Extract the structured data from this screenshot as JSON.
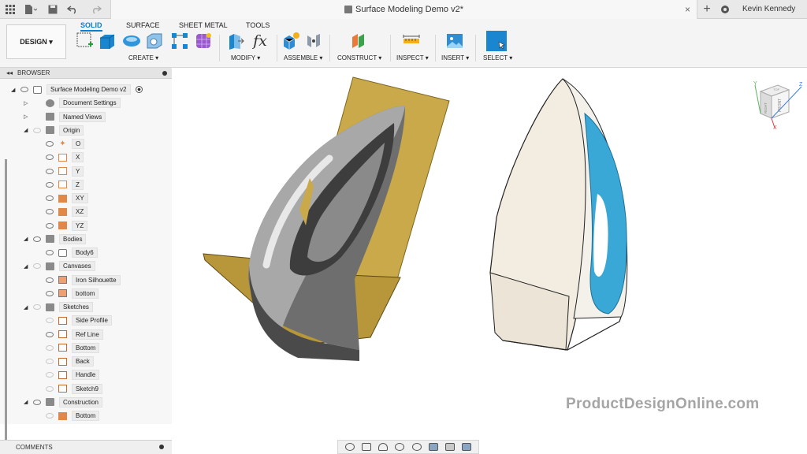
{
  "titlebar": {
    "document_title": "Surface Modeling Demo v2*",
    "user_name": "Kevin Kennedy",
    "close_glyph": "×",
    "add_glyph": "+"
  },
  "ribbon": {
    "workspace_label": "DESIGN ▾",
    "tabs": [
      "SOLID",
      "SURFACE",
      "SHEET METAL",
      "TOOLS"
    ],
    "groups": [
      "CREATE ▾",
      "MODIFY ▾",
      "ASSEMBLE ▾",
      "CONSTRUCT ▾",
      "INSPECT ▾",
      "INSERT ▾",
      "SELECT ▾"
    ],
    "fx_label": "fx"
  },
  "browser": {
    "header": "BROWSER",
    "items": [
      {
        "label": "Surface Modeling Demo v2",
        "icon": "document-icon"
      },
      {
        "label": "Document Settings",
        "icon": "gear-icon"
      },
      {
        "label": "Named Views",
        "icon": "folder-icon"
      },
      {
        "label": "Origin",
        "icon": "folder-icon"
      },
      {
        "label": "O",
        "icon": "origin-point-icon"
      },
      {
        "label": "X",
        "icon": "axis-icon"
      },
      {
        "label": "Y",
        "icon": "axis-icon"
      },
      {
        "label": "Z",
        "icon": "axis-icon"
      },
      {
        "label": "XY",
        "icon": "plane-icon"
      },
      {
        "label": "XZ",
        "icon": "plane-icon"
      },
      {
        "label": "YZ",
        "icon": "plane-icon"
      },
      {
        "label": "Bodies",
        "icon": "folder-icon"
      },
      {
        "label": "Body6",
        "icon": "body-icon"
      },
      {
        "label": "Canvases",
        "icon": "folder-icon"
      },
      {
        "label": "Iron Silhouette",
        "icon": "canvas-icon"
      },
      {
        "label": "bottom",
        "icon": "canvas-icon"
      },
      {
        "label": "Sketches",
        "icon": "folder-icon"
      },
      {
        "label": "Side Profile",
        "icon": "sketch-icon"
      },
      {
        "label": "Ref Line",
        "icon": "sketch-icon"
      },
      {
        "label": "Bottom",
        "icon": "sketch-icon"
      },
      {
        "label": "Back",
        "icon": "sketch-icon"
      },
      {
        "label": "Handle",
        "icon": "sketch-icon"
      },
      {
        "label": "Sketch9",
        "icon": "sketch-icon"
      },
      {
        "label": "Construction",
        "icon": "folder-icon"
      },
      {
        "label": "Bottom",
        "icon": "plane-icon"
      }
    ]
  },
  "comments": {
    "label": "COMMENTS"
  },
  "viewcube": {
    "top_label": "TOP",
    "front_label": "FRONT",
    "right_label": "RIGHT",
    "axis_x": "X",
    "axis_y": "Y",
    "axis_z": "Z"
  },
  "watermark": "ProductDesignOnline.com",
  "colors": {
    "accent": "#0a7ecf",
    "plane": "#e0874a",
    "iron_blue": "#3aa8d6",
    "sketch_plane": "#c9a94a"
  }
}
